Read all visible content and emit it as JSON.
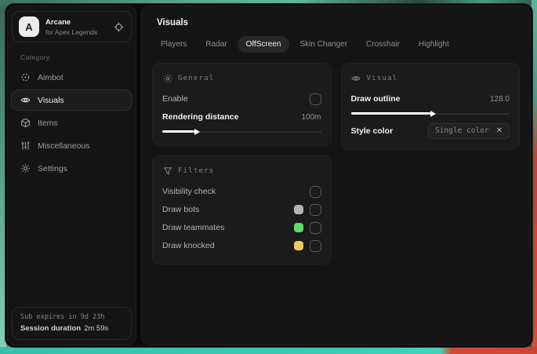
{
  "app": {
    "logo_letter": "A",
    "name": "Arcane",
    "subtitle": "for Apex Legends"
  },
  "sidebar": {
    "category_label": "Category",
    "items": [
      {
        "label": "Aimbot",
        "selected": false
      },
      {
        "label": "Visuals",
        "selected": true
      },
      {
        "label": "Items",
        "selected": false
      },
      {
        "label": "Miscellaneous",
        "selected": false
      },
      {
        "label": "Settings",
        "selected": false
      }
    ],
    "footer": {
      "sub_expires": "Sub expires in 9d 23h",
      "session_label": "Session duration",
      "session_value": "2m 59s"
    }
  },
  "main": {
    "title": "Visuals",
    "tabs": [
      {
        "label": "Players",
        "selected": false
      },
      {
        "label": "Radar",
        "selected": false
      },
      {
        "label": "OffScreen",
        "selected": true
      },
      {
        "label": "Skin Changer",
        "selected": false
      },
      {
        "label": "Crosshair",
        "selected": false
      },
      {
        "label": "Highlight",
        "selected": false
      }
    ],
    "panels": {
      "general": {
        "title": "General",
        "enable_label": "Enable",
        "enable_checked": false,
        "distance_label": "Rendering distance",
        "distance_value": "100m",
        "distance_slider_percent": 20
      },
      "filters": {
        "title": "Filters",
        "rows": [
          {
            "label": "Visibility check",
            "checked": false
          },
          {
            "label": "Draw bots",
            "swatch": "#b5b5b5",
            "checked": false
          },
          {
            "label": "Draw teammates",
            "swatch": "#5ddb6b",
            "checked": false
          },
          {
            "label": "Draw knocked",
            "swatch": "#e8ca5f",
            "checked": false
          }
        ]
      },
      "visual": {
        "title": "Visual",
        "outline_label": "Draw outline",
        "outline_value": "128.0",
        "outline_slider_percent": 50,
        "style_color_label": "Style color",
        "style_color_value": "Single color",
        "clear_icon": "✕"
      }
    }
  },
  "colors": {
    "swatch_bots": "#b5b5b5",
    "swatch_teammates": "#5ddb6b",
    "swatch_knocked": "#e8ca5f",
    "selected_pill_bg": "#272727",
    "panel_bg": "#1b1b1b"
  }
}
